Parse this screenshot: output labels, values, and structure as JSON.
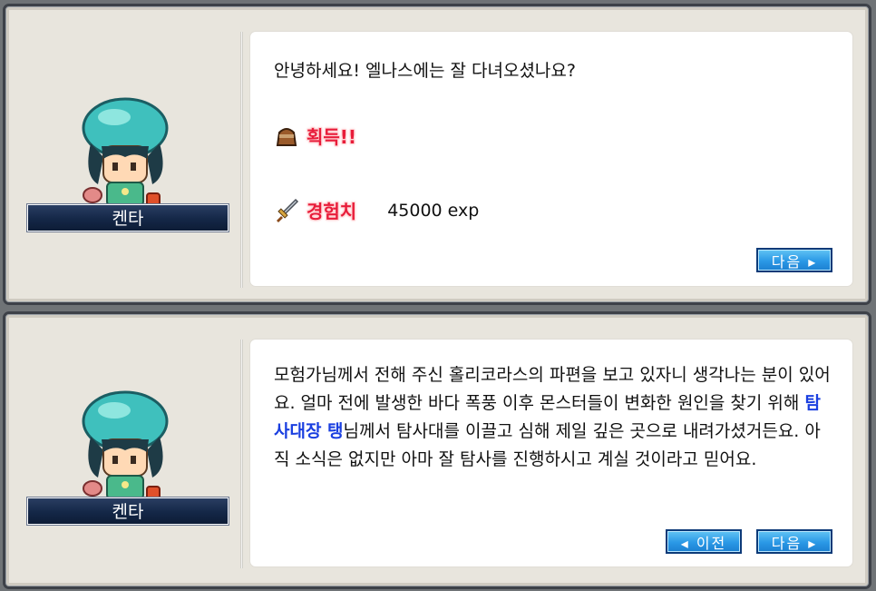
{
  "dialog1": {
    "npc_name": "켄타",
    "greeting": "안녕하세요! 엘나스에는 잘 다녀오셨나요?",
    "reward": {
      "acquired_label": "획득!!",
      "exp_label": "경험치",
      "exp_value": "45000 exp"
    },
    "next_button": "다음 ▸"
  },
  "dialog2": {
    "npc_name": "켄타",
    "message": {
      "part1": "모험가님께서 전해 주신 홀리코라스의 파편을 보고 있자니 생각나는 분이 있어요. 얼마 전에 발생한 바다 폭풍 이후 몬스터들이 변화한 원인을 찾기 위해 ",
      "highlight": "탐사대장 탱",
      "part2": "님께서 탐사대를 이끌고 심해 제일 깊은 곳으로 내려가셨거든요. 아직 소식은 없지만 아마 잘 탐사를 진행하시고 계실 것이라고 믿어요."
    },
    "prev_button": "◂ 이전",
    "next_button": "다음 ▸"
  },
  "icons": {
    "bag": "bag-icon",
    "sword": "sword-icon",
    "npc": "npc-kenta-portrait"
  },
  "colors": {
    "reward_red": "#e81c3a",
    "highlight_blue": "#1a3fe0",
    "nameplate_navy": "#142747",
    "button_blue": "#2a98e6"
  }
}
